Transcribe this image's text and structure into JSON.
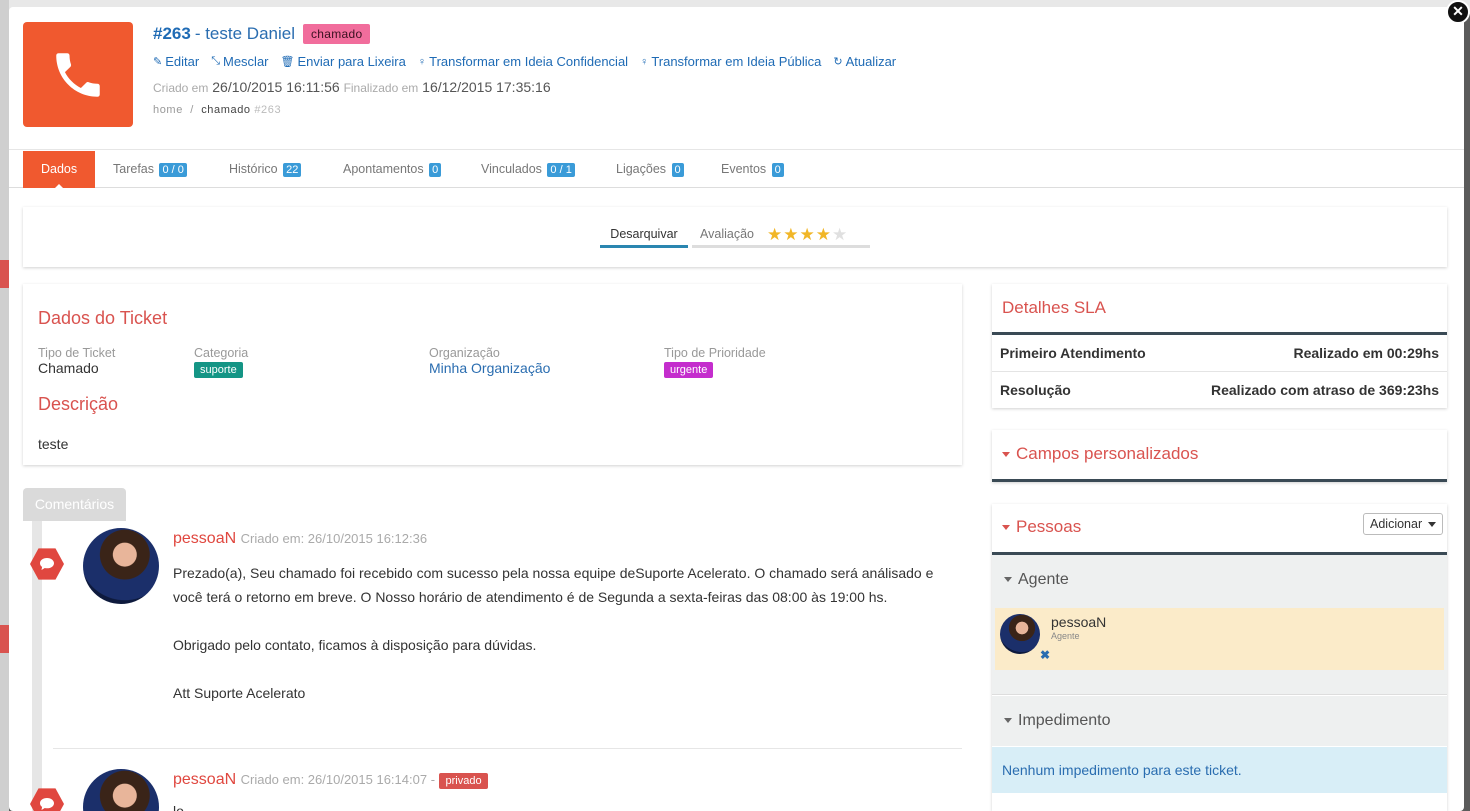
{
  "header": {
    "ticket_number": "#263",
    "ticket_title": "- teste Daniel",
    "type_badge": "chamado",
    "actions": [
      {
        "label": "Editar",
        "icon": "pencil-icon"
      },
      {
        "label": "Mesclar",
        "icon": "merge-icon"
      },
      {
        "label": "Enviar para Lixeira",
        "icon": "trash-icon"
      },
      {
        "label": "Transformar em Ideia Confidencial",
        "icon": "lightbulb-icon"
      },
      {
        "label": "Transformar em Ideia Pública",
        "icon": "lightbulb-icon"
      },
      {
        "label": "Atualizar",
        "icon": "refresh-icon"
      }
    ],
    "created_label": "Criado em",
    "created_value": "26/10/2015 16:11:56",
    "finished_label": "Finalizado em",
    "finished_value": "16/12/2015 17:35:16",
    "breadcrumb": {
      "home": "home",
      "sep": "/",
      "current": "chamado",
      "id": "#263"
    }
  },
  "tabs": [
    {
      "label": "Dados",
      "count": ""
    },
    {
      "label": "Tarefas",
      "count": "0 / 0"
    },
    {
      "label": "Histórico",
      "count": "22"
    },
    {
      "label": "Apontamentos",
      "count": "0"
    },
    {
      "label": "Vinculados",
      "count": "0 / 1"
    },
    {
      "label": "Ligações",
      "count": "0"
    },
    {
      "label": "Eventos",
      "count": "0"
    }
  ],
  "status_bar": {
    "archive_label": "Desarquivar",
    "rating_label": "Avaliação",
    "rating": 4,
    "rating_max": 5
  },
  "ticket_data": {
    "title": "Dados do Ticket",
    "fields": [
      {
        "label": "Tipo de Ticket",
        "value": "Chamado"
      },
      {
        "label": "Categoria",
        "value": "suporte"
      },
      {
        "label": "Organização",
        "value": "Minha Organização"
      },
      {
        "label": "Tipo de Prioridade",
        "value": "urgente"
      }
    ],
    "description_title": "Descrição",
    "description": "teste"
  },
  "comments": {
    "tab_label": "Comentários",
    "items": [
      {
        "author": "pessoaN",
        "date": "Criado em: 26/10/2015 16:12:36",
        "private": "",
        "lines": [
          "Prezado(a), Seu chamado foi recebido com sucesso pela nossa equipe deSuporte Acelerato. O chamado será análisado e",
          "você terá o retorno em breve. O Nosso horário de atendimento é de Segunda a sexta-feiras das 08:00 às 19:00 hs.",
          "Obrigado pelo contato, ficamos à disposição para dúvidas.",
          "Att Suporte Acelerato"
        ]
      },
      {
        "author": "pessoaN",
        "date": "Criado em: 26/10/2015 16:14:07 -",
        "private": "privado",
        "lines": [
          "lo..."
        ]
      }
    ]
  },
  "sla": {
    "title": "Detalhes SLA",
    "rows": [
      {
        "label": "Primeiro Atendimento",
        "value": "Realizado em 00:29hs"
      },
      {
        "label": "Resolução",
        "value": "Realizado com atraso de 369:23hs"
      }
    ]
  },
  "custom_fields": {
    "title": "Campos personalizados"
  },
  "people": {
    "title": "Pessoas",
    "add_button": "Adicionar",
    "agent_section": "Agente",
    "agent_name": "pessoaN",
    "agent_role": "Agente",
    "impediment_section": "Impedimento",
    "impediment_empty": "Nenhum impedimento para este ticket."
  },
  "colors": {
    "accent_orange": "#f0592f",
    "danger_red": "#d9534f",
    "link_blue": "#2a6db0",
    "badge_count": "#3a9bd8"
  }
}
